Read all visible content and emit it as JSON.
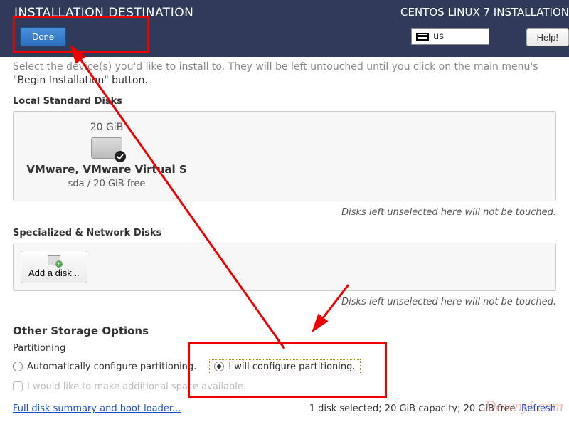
{
  "header": {
    "title": "INSTALLATION DESTINATION",
    "brand": "CENTOS LINUX 7 INSTALLATION",
    "done": "Done",
    "kbd": "us",
    "help": "Help!"
  },
  "intro": {
    "line1": "Select the device(s) you'd like to install to.  They will be left untouched until you click on the main menu's",
    "line2": "\"Begin Installation\" button."
  },
  "localDisks": {
    "label": "Local Standard Disks",
    "capacity": "20 GiB",
    "name": "VMware, VMware Virtual S",
    "sub": "sda    /    20 GiB free",
    "note": "Disks left unselected here will not be touched."
  },
  "netDisks": {
    "label": "Specialized & Network Disks",
    "addBtn": "Add a disk...",
    "note": "Disks left unselected here will not be touched."
  },
  "storage": {
    "title": "Other Storage Options",
    "partLabel": "Partitioning",
    "auto": "Automatically configure partitioning.",
    "manual": "I will configure partitioning.",
    "extra": "I would like to make additional space available."
  },
  "footer": {
    "link": "Full disk summary and boot loader...",
    "status": "1 disk selected; 20 GiB capacity; 20 GiB free",
    "refresh": "Refresh"
  },
  "watermark": "Downyi.com"
}
